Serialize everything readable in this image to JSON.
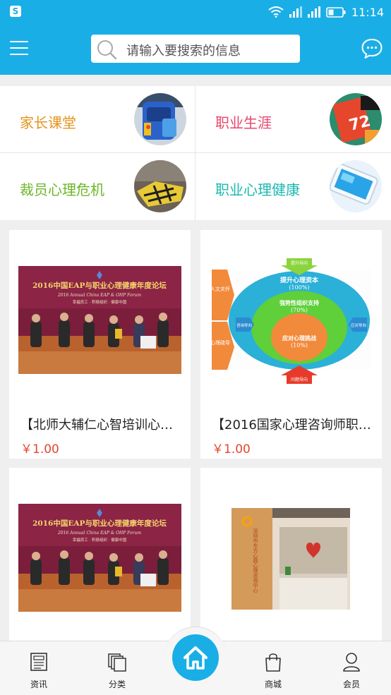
{
  "status_bar": {
    "time": "11:14",
    "icons": [
      "app-badge-icon",
      "wifi-icon",
      "signal-icon",
      "signal-icon",
      "battery-icon"
    ],
    "app_badge": "S"
  },
  "header": {
    "menu_icon": "hamburger-menu-icon",
    "search": {
      "placeholder": "请输入要搜索的信息",
      "icon": "search-icon"
    },
    "chat_icon": "chat-bubble-icon",
    "color": "#1aaee6"
  },
  "categories": [
    {
      "label": "家长课堂",
      "color": "#e5931e"
    },
    {
      "label": "职业生涯",
      "color": "#e8456b"
    },
    {
      "label": "裁员心理危机",
      "color": "#6cb62a"
    },
    {
      "label": "职业心理健康",
      "color": "#1cb8b0"
    }
  ],
  "products": [
    {
      "title": "【北师大辅仁心智培训心…",
      "price": "￥1.00",
      "image": {
        "banner_title": "2016中国EAP与职业心理健康年度论坛",
        "banner_subtitle": "2016 Annual China EAP & OHP Forum",
        "banner_tagline": "幸福员工 · 积极组织 · 健康中国"
      }
    },
    {
      "title": "【2016国家心理咨询师职…",
      "price": "￥1.00",
      "image": {
        "top_arrow": "提升导向",
        "outer_ring": "提升心理资本",
        "outer_ring_pct": "(100%)",
        "middle_ring": "强势性组织支持",
        "middle_ring_pct": "(70%)",
        "inner_ring": "应对心理挑战",
        "inner_ring_pct": "(10%)",
        "left_top": "人文关怀",
        "left_bottom": "心理疏导",
        "left_mid": "咨询导向",
        "right_mid": "应对导向",
        "bottom_arrow": "问题导向"
      }
    },
    {
      "title": "",
      "price": "",
      "image": {
        "banner_title": "2016中国EAP与职业心理健康年度论坛",
        "banner_subtitle": "2016 Annual China EAP & OHP Forum",
        "banner_tagline": "幸福员工 · 积极组织 · 健康中国"
      }
    },
    {
      "title": "",
      "price": "",
      "image": {
        "wall_text": "深圳市东方心圆心理咨询中心"
      }
    }
  ],
  "bottom_nav": {
    "items": [
      {
        "label": "资讯",
        "icon": "news-icon"
      },
      {
        "label": "分类",
        "icon": "category-icon"
      },
      {
        "label": "",
        "icon": "home-icon"
      },
      {
        "label": "商城",
        "icon": "shopping-bag-icon"
      },
      {
        "label": "会员",
        "icon": "user-icon"
      }
    ]
  }
}
